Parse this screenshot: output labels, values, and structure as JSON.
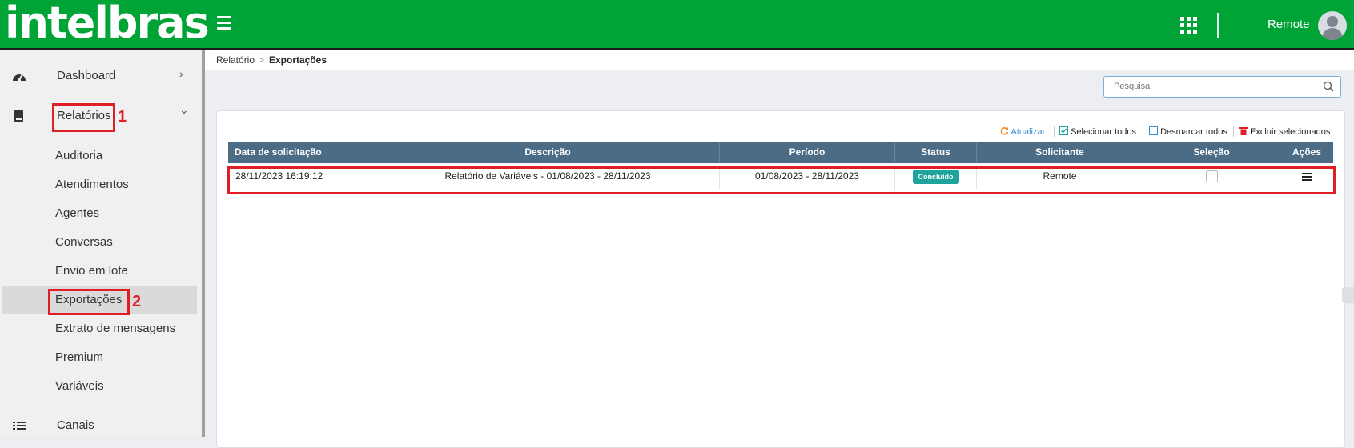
{
  "brand": {
    "logo": "intelbras",
    "primary_color": "#00a335",
    "header_color": "#4c6b84"
  },
  "topbar": {
    "user_name": "Remote",
    "menu_icon": "hamburger-icon",
    "apps_icon": "apps-grid-icon",
    "avatar_icon": "user-avatar-icon"
  },
  "sidebar": {
    "items": [
      {
        "label": "Dashboard",
        "icon": "dashboard-gauge-icon",
        "arrow": "›"
      },
      {
        "label": "Relatórios",
        "icon": "book-icon",
        "arrow": "⌄",
        "expanded": true
      },
      {
        "label": "Canais",
        "icon": "list-icon"
      }
    ],
    "subitems": [
      {
        "label": "Auditoria"
      },
      {
        "label": "Atendimentos"
      },
      {
        "label": "Agentes"
      },
      {
        "label": "Conversas"
      },
      {
        "label": "Envio em lote"
      },
      {
        "label": "Exportações",
        "active": true
      },
      {
        "label": "Extrato de mensagens"
      },
      {
        "label": "Premium"
      },
      {
        "label": "Variáveis"
      }
    ]
  },
  "annotations": {
    "first": "1",
    "second": "2",
    "color": "#e01e25"
  },
  "breadcrumb": {
    "parent": "Relatório",
    "separator": ">",
    "current": "Exportações"
  },
  "search": {
    "placeholder": "Pesquisa",
    "value": ""
  },
  "toolbar": {
    "refresh": "Atualizar",
    "select_all": "Selecionar todos",
    "deselect_all": "Desmarcar todos",
    "delete_selected": "Excluir selecionados"
  },
  "table": {
    "columns": [
      "Data de solicitação",
      "Descrição",
      "Período",
      "Status",
      "Solicitante",
      "Seleção",
      "Ações"
    ],
    "rows": [
      {
        "date": "28/11/2023 16:19:12",
        "description": "Relatório de Variáveis - 01/08/2023 - 28/11/2023",
        "period": "01/08/2023 - 28/11/2023",
        "status": "Concluído",
        "requester": "Remote",
        "selected": false
      }
    ]
  }
}
